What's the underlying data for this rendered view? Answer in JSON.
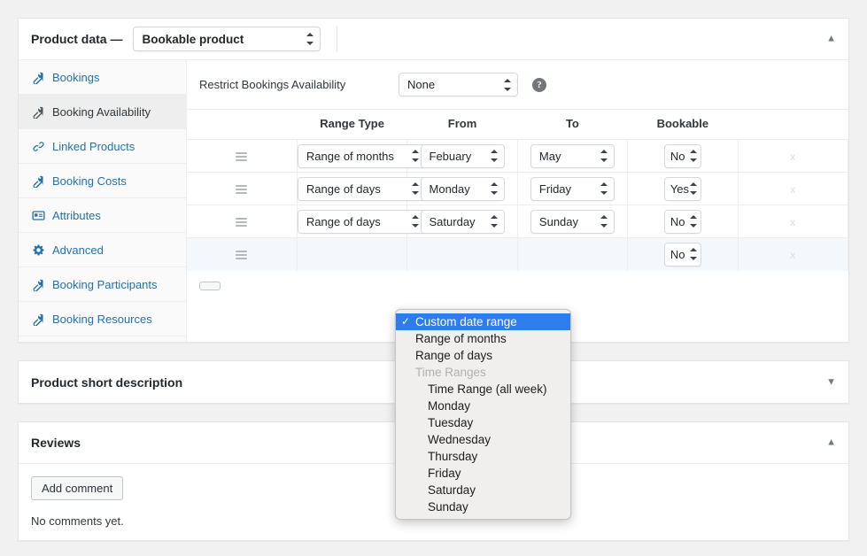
{
  "product_data": {
    "title": "Product data —",
    "product_type": "Bookable product",
    "toggle_icon": "▲",
    "tabs": [
      {
        "label": "Bookings",
        "icon": "wrench-icon",
        "active": false
      },
      {
        "label": "Booking Availability",
        "icon": "wrench-icon",
        "active": true
      },
      {
        "label": "Linked Products",
        "icon": "link-icon",
        "active": false
      },
      {
        "label": "Booking Costs",
        "icon": "wrench-icon",
        "active": false
      },
      {
        "label": "Attributes",
        "icon": "attributes-icon",
        "active": false
      },
      {
        "label": "Advanced",
        "icon": "gear-icon",
        "active": false
      },
      {
        "label": "Booking Participants",
        "icon": "wrench-icon",
        "active": false
      },
      {
        "label": "Booking Resources",
        "icon": "wrench-icon",
        "active": false
      }
    ],
    "restrict": {
      "label": "Restrict Bookings Availability",
      "value": "None",
      "help_glyph": "?"
    },
    "availability_table": {
      "columns": [
        "Range Type",
        "From",
        "To",
        "Bookable"
      ],
      "rows": [
        {
          "range_type": "Range of months",
          "from": "Febuary",
          "to": "May",
          "bookable": "No",
          "delete": "x",
          "active": false
        },
        {
          "range_type": "Range of days",
          "from": "Monday",
          "to": "Friday",
          "bookable": "Yes",
          "delete": "x",
          "active": false
        },
        {
          "range_type": "Range of days",
          "from": "Saturday",
          "to": "Sunday",
          "bookable": "No",
          "delete": "x",
          "active": false
        },
        {
          "range_type": "",
          "from": "",
          "to": "",
          "bookable": "No",
          "delete": "x",
          "active": true
        }
      ],
      "add_button": ""
    },
    "dropdown": {
      "options": [
        {
          "label": "Custom date range",
          "selected": true,
          "group": false,
          "indent": false
        },
        {
          "label": "Range of months",
          "selected": false,
          "group": false,
          "indent": false
        },
        {
          "label": "Range of days",
          "selected": false,
          "group": false,
          "indent": false
        },
        {
          "label": "Time Ranges",
          "selected": false,
          "group": true,
          "indent": false
        },
        {
          "label": "Time Range (all week)",
          "selected": false,
          "group": false,
          "indent": true
        },
        {
          "label": "Monday",
          "selected": false,
          "group": false,
          "indent": true
        },
        {
          "label": "Tuesday",
          "selected": false,
          "group": false,
          "indent": true
        },
        {
          "label": "Wednesday",
          "selected": false,
          "group": false,
          "indent": true
        },
        {
          "label": "Thursday",
          "selected": false,
          "group": false,
          "indent": true
        },
        {
          "label": "Friday",
          "selected": false,
          "group": false,
          "indent": true
        },
        {
          "label": "Saturday",
          "selected": false,
          "group": false,
          "indent": true
        },
        {
          "label": "Sunday",
          "selected": false,
          "group": false,
          "indent": true
        }
      ]
    }
  },
  "short_description": {
    "title": "Product short description",
    "toggle_icon": "▼"
  },
  "reviews": {
    "title": "Reviews",
    "toggle_icon": "▲",
    "add_comment_label": "Add comment",
    "empty_text": "No comments yet."
  },
  "colors": {
    "accent": "#2271b1",
    "highlight": "#2f7ced",
    "page_bg": "#f1f1f1",
    "panel_bg": "#ffffff",
    "tab_bg": "#fafafa",
    "tab_active_bg": "#eeeeee"
  }
}
